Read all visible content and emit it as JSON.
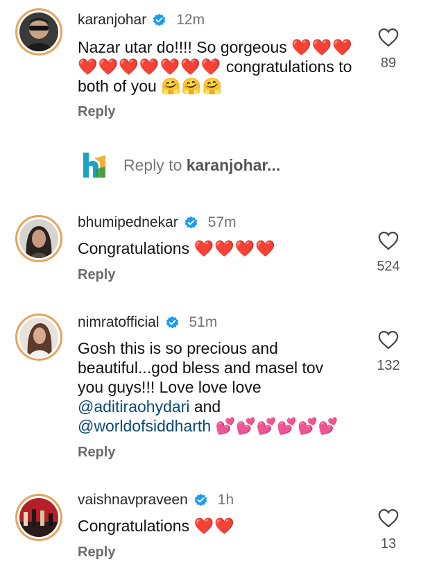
{
  "comments": [
    {
      "username": "karanjohar",
      "time": "12m",
      "text_line1": "Nazar utar do!!!! So gorgeous ",
      "hearts1": "❤️❤️❤️",
      "hearts2": "❤️❤️❤️❤️❤️❤️❤️",
      "text_line2": " congratulations to",
      "text_line3": "both of you ",
      "hugs": "🤗🤗🤗",
      "reply_label": "Reply",
      "likes": "89"
    },
    {
      "username": "bhumipednekar",
      "time": "57m",
      "text": "Congratulations ",
      "hearts": "❤️❤️❤️❤️",
      "reply_label": "Reply",
      "likes": "524"
    },
    {
      "username": "nimratofficial",
      "time": "51m",
      "text_line1": "Gosh this is so precious and",
      "text_line2": "beautiful...god bless and masel tov",
      "text_line3": "you guys!!! Love love love",
      "mention1": "@aditiraohydari",
      "and": " and",
      "mention2": "@worldofsiddharth",
      "pinks": "💕💕💕💕💕💕",
      "reply_label": "Reply",
      "likes": "132"
    },
    {
      "username": "vaishnavpraveen",
      "time": "1h",
      "text": "Congratulations ",
      "hearts": "❤️❤️",
      "reply_label": "Reply",
      "likes": "13"
    }
  ],
  "reply_input": {
    "prefix": "Reply to ",
    "target": "karanjohar...",
    "logo_text": "bh"
  },
  "colors": {
    "verified": "#1d9bf0",
    "ring": "#e8a35a",
    "mention": "#0a4a78"
  },
  "icons": {
    "like": "heart-outline-icon",
    "verified": "verified-badge-icon"
  }
}
